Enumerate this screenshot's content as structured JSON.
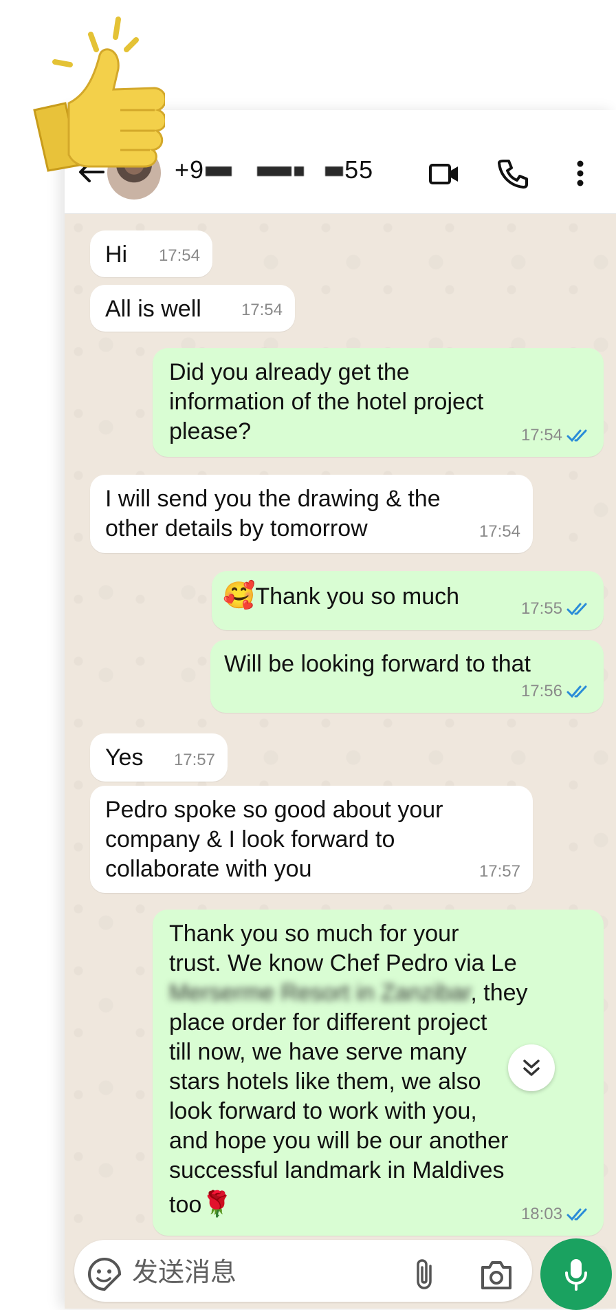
{
  "header": {
    "contact_prefix": "+9",
    "contact_suffix": "55"
  },
  "messages": [
    {
      "text": "Hi",
      "time": "17:54"
    },
    {
      "text": "All is well",
      "time": "17:54"
    },
    {
      "lines": [
        "Did you already get the",
        "information of the hotel project",
        "please?"
      ],
      "time": "17:54"
    },
    {
      "lines": [
        "I will send you the drawing & the",
        "other details by tomorrow"
      ],
      "time": "17:54"
    },
    {
      "text": "Thank you so much",
      "emoji": "🥰",
      "time": "17:55"
    },
    {
      "text": "Will be looking forward to that",
      "time": "17:56"
    },
    {
      "text": "Yes",
      "time": "17:57"
    },
    {
      "lines": [
        "Pedro spoke so good about your",
        "company & I look forward to",
        "collaborate with you"
      ],
      "time": "17:57"
    },
    {
      "lines": [
        "Thank you so much for your",
        "trust. We know Chef Pedro via Le",
        ", they",
        "place order for different project",
        "till now, we have serve many",
        "stars hotels like them, we also",
        "look forward to work with you,",
        "and hope you will be our another",
        "successful landmark in Maldives",
        "too"
      ],
      "blurred": "Merserme Resort in Zanzibar",
      "emoji": "🌹",
      "time": "18:03"
    }
  ],
  "composer": {
    "placeholder": "发送消息"
  },
  "colors": {
    "incoming": "#ffffff",
    "outgoing": "#d9fdd3",
    "read_tick": "#2a8cd8",
    "mic": "#1aa260"
  },
  "icons": [
    "thumbs-up-icon",
    "back-arrow-icon",
    "video-call-icon",
    "phone-icon",
    "more-options-icon",
    "scroll-down-icon",
    "sticker-icon",
    "attach-icon",
    "camera-icon",
    "mic-icon"
  ]
}
